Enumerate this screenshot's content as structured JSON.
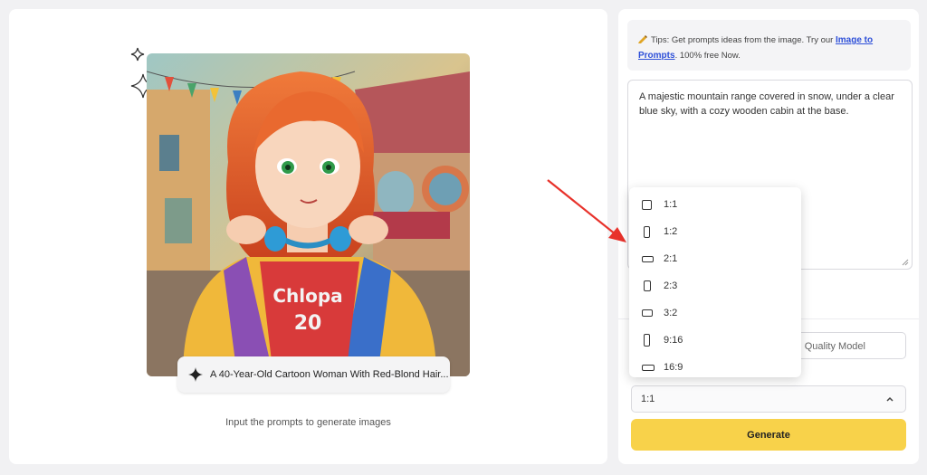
{
  "main": {
    "image_caption": "A 40-Year-Old Cartoon Woman With Red-Blond Hair...",
    "hint": "Input the prompts to generate images",
    "shirt_text": "Chlopa",
    "shirt_number": "20"
  },
  "tips": {
    "prefix": "Tips: Get prompts ideas from the image. Try our ",
    "link_label": "Image to Prompts",
    "suffix": ". 100% free Now."
  },
  "prompt": {
    "value": "A majestic mountain range covered in snow, under a clear blue sky, with a cozy wooden cabin at the base."
  },
  "model_select": {
    "value": "Quality Model"
  },
  "ratio_select": {
    "value": "1:1"
  },
  "generate_label": "Generate",
  "ratio_options": [
    {
      "label": "1:1",
      "icon": "square-icon"
    },
    {
      "label": "1:2",
      "icon": "portrait-icon"
    },
    {
      "label": "2:1",
      "icon": "landscape-icon"
    },
    {
      "label": "2:3",
      "icon": "portrait-icon"
    },
    {
      "label": "3:2",
      "icon": "landscape-icon"
    },
    {
      "label": "9:16",
      "icon": "portrait-icon"
    },
    {
      "label": "16:9",
      "icon": "landscape-icon"
    }
  ],
  "colors": {
    "accent_yellow": "#f8d24a",
    "link_blue": "#2d4fd8",
    "arrow_red": "#e8322b"
  }
}
